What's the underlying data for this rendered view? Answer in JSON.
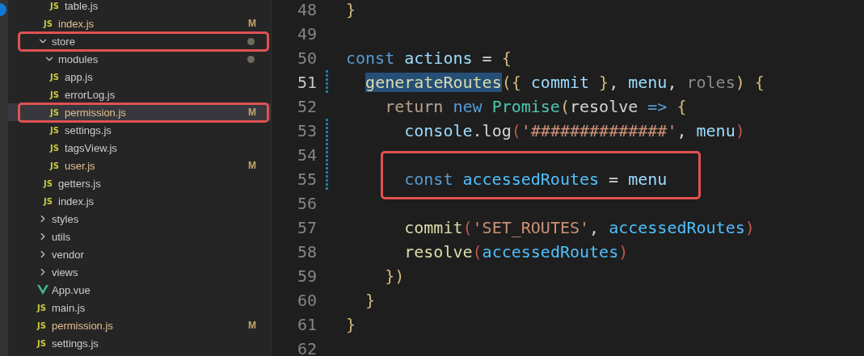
{
  "explorer": {
    "tree": [
      {
        "children": [
          {
            "children": [
              {
                "label": "table.js",
                "kind": "js",
                "icon_label": "JS",
                "selected": false
              }
            ]
          },
          {
            "label": "index.js",
            "kind": "js",
            "icon_label": "JS",
            "status": "M",
            "selected": false
          }
        ]
      },
      {
        "label": "store",
        "kind": "folder",
        "expanded": true,
        "has_changes": true,
        "annotated": true,
        "selected": false,
        "children": [
          {
            "label": "modules",
            "kind": "folder",
            "expanded": true,
            "has_changes": true,
            "selected": false,
            "children": [
              {
                "label": "app.js",
                "kind": "js",
                "icon_label": "JS",
                "selected": false
              },
              {
                "label": "errorLog.js",
                "kind": "js",
                "icon_label": "JS",
                "selected": false
              },
              {
                "label": "permission.js",
                "kind": "js",
                "icon_label": "JS",
                "status": "M",
                "selected": true,
                "annotated": true
              },
              {
                "label": "settings.js",
                "kind": "js",
                "icon_label": "JS",
                "selected": false
              },
              {
                "label": "tagsView.js",
                "kind": "js",
                "icon_label": "JS",
                "selected": false
              },
              {
                "label": "user.js",
                "kind": "js",
                "icon_label": "JS",
                "status": "M",
                "selected": false
              }
            ]
          },
          {
            "label": "getters.js",
            "kind": "js",
            "icon_label": "JS",
            "selected": false
          },
          {
            "label": "index.js",
            "kind": "js",
            "icon_label": "JS",
            "selected": false
          }
        ]
      },
      {
        "label": "styles",
        "kind": "folder",
        "expanded": false,
        "selected": false
      },
      {
        "label": "utils",
        "kind": "folder",
        "expanded": false,
        "selected": false
      },
      {
        "label": "vendor",
        "kind": "folder",
        "expanded": false,
        "selected": false
      },
      {
        "label": "views",
        "kind": "folder",
        "expanded": false,
        "selected": false
      },
      {
        "label": "App.vue",
        "kind": "vue",
        "selected": false
      },
      {
        "label": "main.js",
        "kind": "js",
        "icon_label": "JS",
        "selected": false
      },
      {
        "label": "permission.js",
        "kind": "js",
        "icon_label": "JS",
        "status": "M",
        "selected": false
      },
      {
        "label": "settings.js",
        "kind": "js",
        "icon_label": "JS",
        "selected": false
      }
    ]
  },
  "editor": {
    "lines": [
      {
        "number": "48",
        "current": false,
        "changed": false,
        "tokens": [
          {
            "text": "}",
            "kind": "brace"
          }
        ]
      },
      {
        "number": "49",
        "current": false,
        "changed": false
      },
      {
        "number": "50",
        "current": false,
        "changed": false,
        "tokens": [
          {
            "text": "const ",
            "kind": "keyword"
          },
          {
            "text": "actions",
            "kind": "variable"
          },
          {
            "text": " = "
          },
          {
            "text": "{",
            "kind": "brace"
          }
        ]
      },
      {
        "number": "51",
        "current": true,
        "changed": true,
        "tokens": [
          {
            "text": "  generateRoutes",
            "kind": "function",
            "selected": true
          },
          {
            "text": "({ ",
            "kind": "brace"
          },
          {
            "text": "commit",
            "kind": "variable"
          },
          {
            "text": " }",
            "kind": "brace"
          },
          {
            "text": ", "
          },
          {
            "text": "menu",
            "kind": "variable"
          },
          {
            "text": ", "
          },
          {
            "text": "roles",
            "kind": "unused"
          },
          {
            "text": ") {",
            "kind": "brace"
          }
        ]
      },
      {
        "number": "52",
        "current": false,
        "changed": false,
        "tokens": [
          {
            "text": "    return ",
            "kind": "control"
          },
          {
            "text": "new ",
            "kind": "keyword"
          },
          {
            "text": "Promise",
            "kind": "class"
          },
          {
            "text": "(",
            "kind": "brace"
          },
          {
            "text": "resolve "
          },
          {
            "text": "=> ",
            "kind": "keyword"
          },
          {
            "text": "{",
            "kind": "brace"
          }
        ]
      },
      {
        "number": "53",
        "current": false,
        "changed": true,
        "tokens": [
          {
            "text": "      console",
            "kind": "variable"
          },
          {
            "text": ".log"
          },
          {
            "text": "(",
            "kind": "paren"
          },
          {
            "text": "'##############'",
            "kind": "string"
          },
          {
            "text": ", "
          },
          {
            "text": "menu",
            "kind": "variable"
          },
          {
            "text": ")",
            "kind": "paren"
          }
        ]
      },
      {
        "number": "54",
        "current": false,
        "changed": true
      },
      {
        "number": "55",
        "current": false,
        "changed": true,
        "annotated": true,
        "tokens": [
          {
            "text": "      const ",
            "kind": "keyword"
          },
          {
            "text": "accessedRoutes",
            "kind": "constant"
          },
          {
            "text": " = "
          },
          {
            "text": "menu",
            "kind": "variable"
          }
        ]
      },
      {
        "number": "56",
        "current": false,
        "changed": false
      },
      {
        "number": "57",
        "current": false,
        "changed": false,
        "tokens": [
          {
            "text": "      commit",
            "kind": "function"
          },
          {
            "text": "(",
            "kind": "paren"
          },
          {
            "text": "'SET_ROUTES'",
            "kind": "string"
          },
          {
            "text": ", "
          },
          {
            "text": "accessedRoutes",
            "kind": "constant"
          },
          {
            "text": ")",
            "kind": "paren"
          }
        ]
      },
      {
        "number": "58",
        "current": false,
        "changed": false,
        "tokens": [
          {
            "text": "      resolve",
            "kind": "function"
          },
          {
            "text": "(",
            "kind": "paren"
          },
          {
            "text": "accessedRoutes",
            "kind": "constant"
          },
          {
            "text": ")",
            "kind": "paren"
          }
        ]
      },
      {
        "number": "59",
        "current": false,
        "changed": false,
        "tokens": [
          {
            "text": "    })",
            "kind": "brace"
          }
        ]
      },
      {
        "number": "60",
        "current": false,
        "changed": false,
        "tokens": [
          {
            "text": "  }",
            "kind": "brace"
          }
        ]
      },
      {
        "number": "61",
        "current": false,
        "changed": false,
        "tokens": [
          {
            "text": "}",
            "kind": "brace"
          }
        ]
      },
      {
        "number": "62",
        "current": false,
        "changed": false
      }
    ]
  }
}
